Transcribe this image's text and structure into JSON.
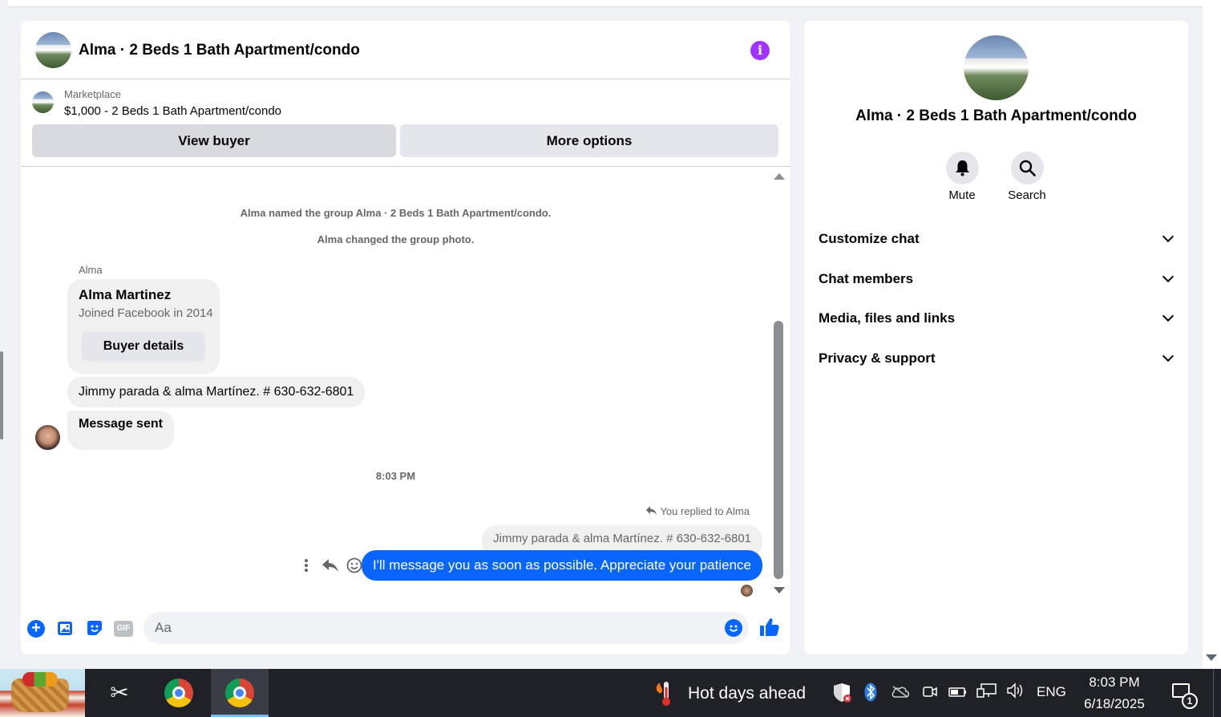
{
  "colors": {
    "accent": "#0866ff",
    "info_icon": "#a033ff",
    "page_bg": "#f0f2f5",
    "taskbar": "#1f2127"
  },
  "header": {
    "title": "Alma · 2 Beds 1 Bath Apartment/condo",
    "info_icon": "info-icon"
  },
  "marketplace": {
    "label": "Marketplace",
    "listing": "$1,000 - 2 Beds 1 Bath Apartment/condo",
    "view_buyer_label": "View buyer",
    "more_options_label": "More options"
  },
  "messages": {
    "system_1": "Alma named the group Alma · 2 Beds 1 Bath Apartment/condo.",
    "system_2": "Alma changed the group photo.",
    "sender": "Alma",
    "card_name": "Alma Martinez",
    "card_sub": "Joined Facebook in 2014",
    "card_button": "Buyer details",
    "incoming_1": "Jimmy parada & alma Martínez. # 630-632-6801",
    "incoming_2": "Message sent",
    "time": "8:03 PM",
    "reply_note": "You replied to Alma",
    "quoted": "Jimmy parada & alma Martínez. # 630-632-6801",
    "outgoing": "I'll message you as soon as possible. Appreciate your patience"
  },
  "composer": {
    "placeholder": "Aa",
    "gif_label": "GIF"
  },
  "info_panel": {
    "title": "Alma · 2 Beds 1 Bath Apartment/condo",
    "mute_label": "Mute",
    "search_label": "Search",
    "sections": [
      "Customize chat",
      "Chat members",
      "Media, files and links",
      "Privacy & support"
    ]
  },
  "taskbar": {
    "weather": "Hot days ahead",
    "language": "ENG",
    "time": "8:03 PM",
    "date": "6/18/2025",
    "notification_count": "1"
  }
}
